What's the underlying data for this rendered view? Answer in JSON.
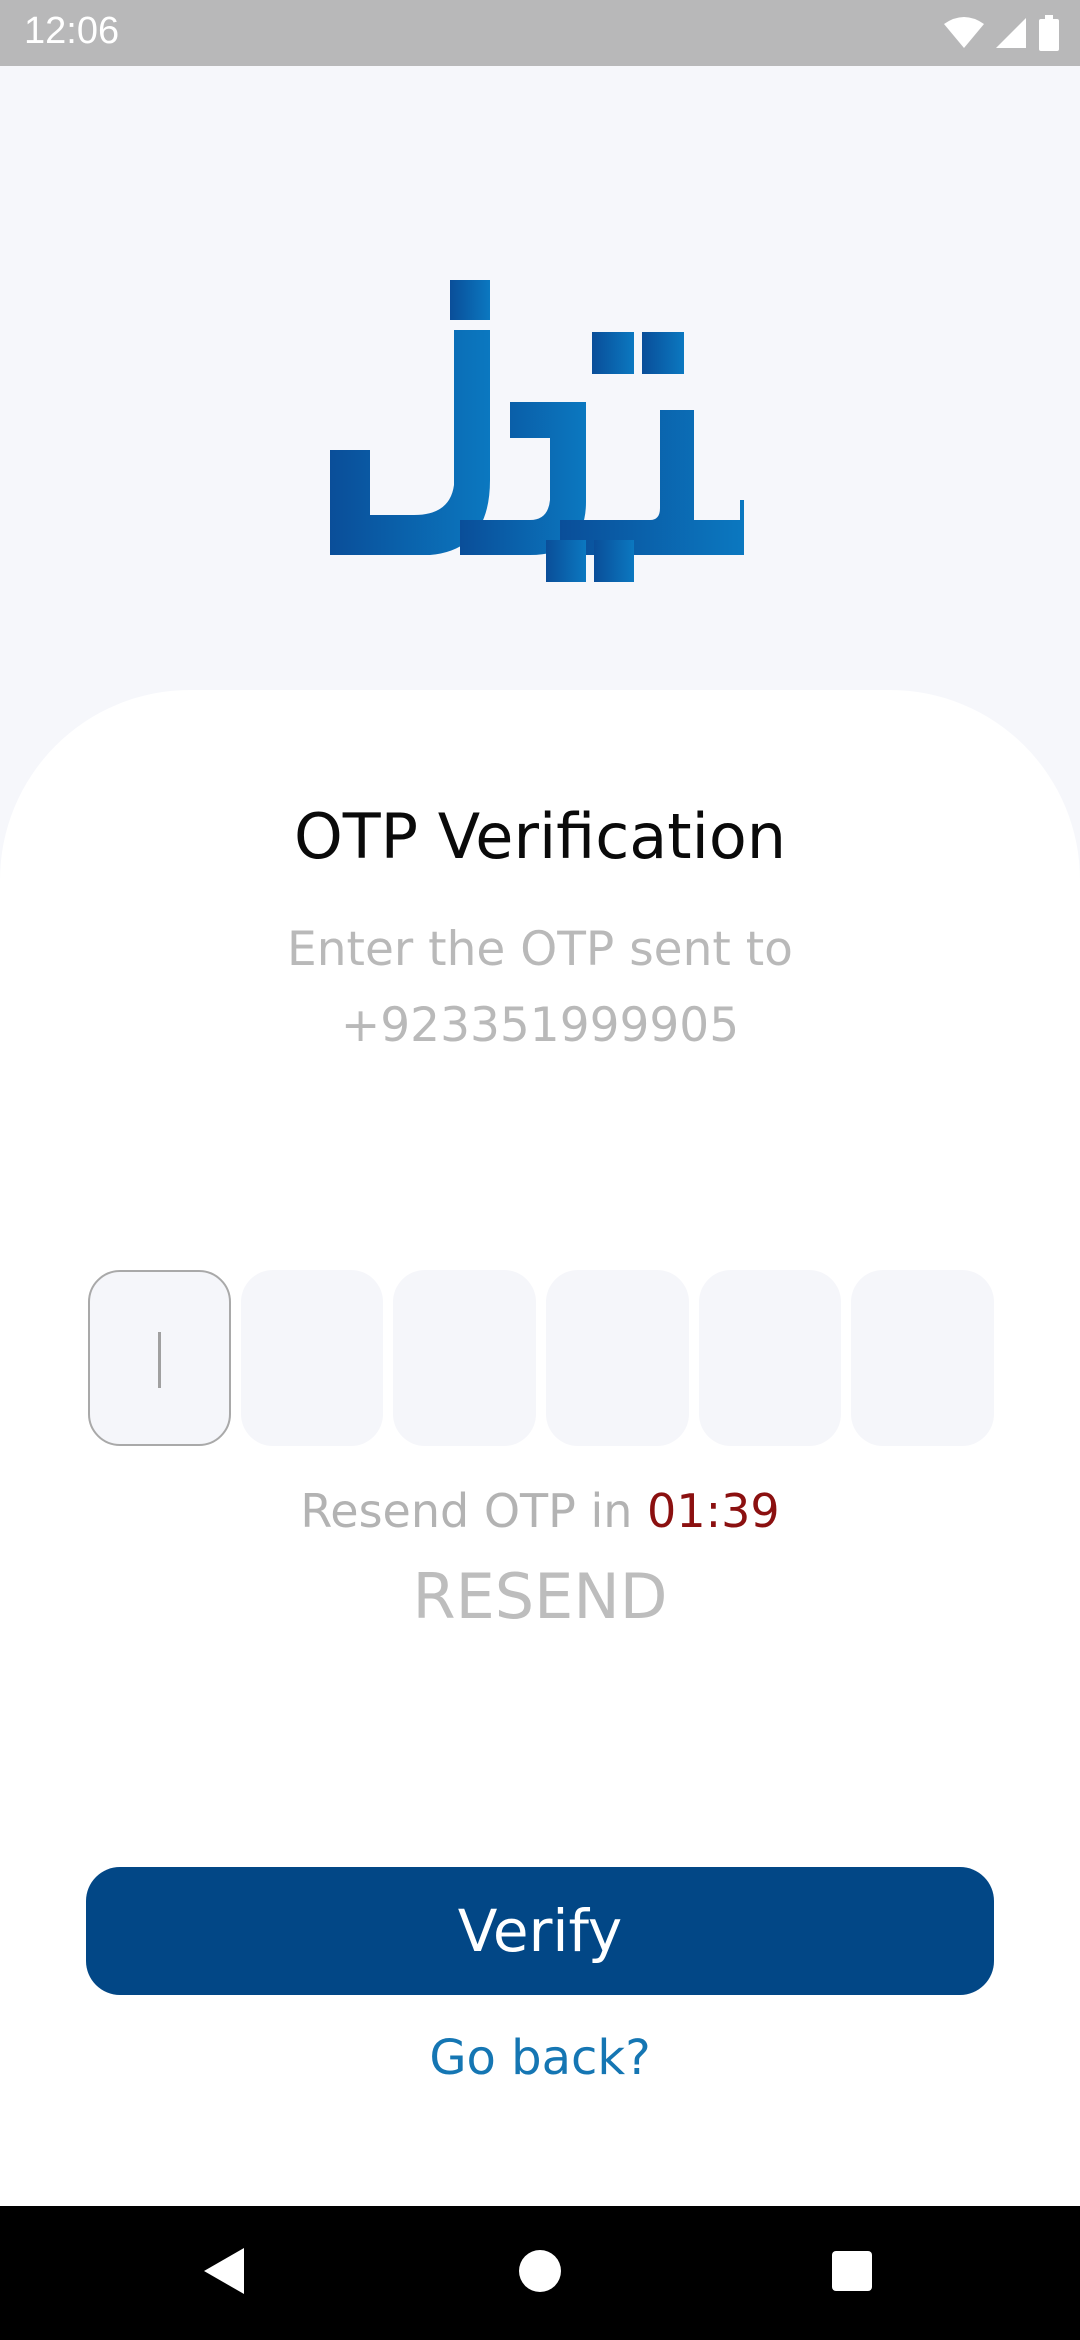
{
  "status_bar": {
    "time": "12:06",
    "icons": [
      "wifi-icon",
      "signal-icon",
      "battery-icon"
    ]
  },
  "logo": {
    "name": "tez-logo",
    "colors": [
      "#0a4e99",
      "#0b75bf"
    ]
  },
  "otp": {
    "title": "OTP Verification",
    "subtitle_line1": "Enter the OTP sent to",
    "phone": "+923351999905",
    "boxes": [
      "",
      "",
      "",
      "",
      "",
      ""
    ],
    "resend_prefix": "Resend OTP in ",
    "timer": "01:39",
    "resend_label": "RESEND"
  },
  "actions": {
    "verify_label": "Verify",
    "go_back_label": "Go back?"
  },
  "colors": {
    "primary": "#024786",
    "link": "#1576b3",
    "timer": "#8b1010",
    "muted": "#b9b9b9"
  },
  "nav_bar": {
    "icons": [
      "back-triangle-icon",
      "home-circle-icon",
      "recents-square-icon"
    ]
  }
}
